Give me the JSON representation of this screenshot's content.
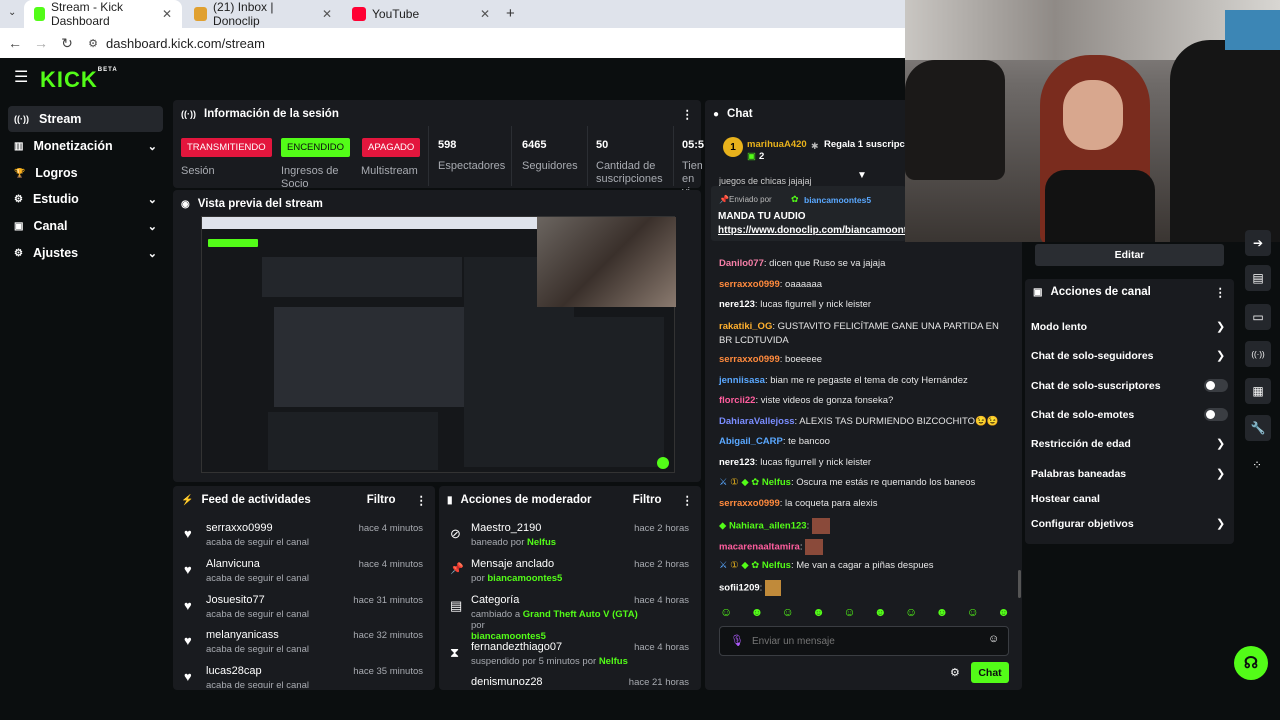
{
  "browser": {
    "tabs": [
      {
        "label": "Stream - Kick Dashboard",
        "active": true,
        "color": "#53fc18"
      },
      {
        "label": "(21) Inbox | Donoclip",
        "active": false,
        "color": "#e0a030"
      },
      {
        "label": "YouTube",
        "active": false,
        "color": "#ff0033"
      }
    ],
    "new_tab": "+",
    "url": "dashboard.kick.com/stream"
  },
  "brand": {
    "logo": "KICK",
    "beta": "BETA",
    "accent": "#53fc18"
  },
  "sidebar": {
    "items": [
      {
        "label": "Stream",
        "icon": "broadcast-icon",
        "glyph": "((·))"
      },
      {
        "label": "Monetización",
        "icon": "monetization-icon",
        "glyph": "▥"
      },
      {
        "label": "Logros",
        "icon": "trophy-icon",
        "glyph": "🏆"
      },
      {
        "label": "Estudio",
        "icon": "studio-icon",
        "glyph": "⚙"
      },
      {
        "label": "Canal",
        "icon": "channel-icon",
        "glyph": "▣"
      },
      {
        "label": "Ajustes",
        "icon": "gear-icon",
        "glyph": "⚙"
      }
    ]
  },
  "session": {
    "title": "Información de la sesión",
    "status": [
      {
        "badge": "TRANSMITIENDO",
        "label": "Sesión",
        "color": "#e3163d"
      },
      {
        "badge": "ENCENDIDO",
        "label": "Ingresos de Socio",
        "color": "#53fc18"
      },
      {
        "badge": "APAGADO",
        "label": "Multistream",
        "color": "#e3163d"
      }
    ],
    "stats": [
      {
        "value": "598",
        "label": "Espectadores"
      },
      {
        "value": "6465",
        "label": "Seguidores"
      },
      {
        "value": "50",
        "label": "Cantidad de suscripciones"
      },
      {
        "value": "05:5",
        "label": "Tiem en vi"
      }
    ]
  },
  "preview": {
    "title": "Vista previa del stream"
  },
  "feed": {
    "title": "Feed de actividades",
    "filter": "Filtro",
    "items": [
      {
        "name": "serraxxo0999",
        "sub": "acaba de seguir el canal",
        "time": "hace 4 minutos"
      },
      {
        "name": "Alanvicuna",
        "sub": "acaba de seguir el canal",
        "time": "hace 4 minutos"
      },
      {
        "name": "Josuesito77",
        "sub": "acaba de seguir el canal",
        "time": "hace 31 minutos"
      },
      {
        "name": "melanyanicass",
        "sub": "acaba de seguir el canal",
        "time": "hace 32 minutos"
      },
      {
        "name": "lucas28cap",
        "sub": "acaba de seguir el canal",
        "time": "hace 35 minutos"
      }
    ]
  },
  "mod": {
    "title": "Acciones de moderador",
    "filter": "Filtro",
    "items": [
      {
        "icon": "ban-icon",
        "glyph": "⊘",
        "name": "Maestro_2190",
        "pre": "baneado por ",
        "by": "Nelfus",
        "time": "hace 2 horas"
      },
      {
        "icon": "pin-icon",
        "glyph": "📌",
        "name": "Mensaje anclado",
        "pre": "por ",
        "by": "biancamoontes5",
        "time": "hace 2 horas"
      },
      {
        "icon": "category-icon",
        "glyph": "▤",
        "name": "Categoría",
        "pre": "cambiado a ",
        "by": "Grand Theft Auto V (GTA)",
        "post": " por",
        "by2": "biancamoontes5",
        "time": "hace 4 horas"
      },
      {
        "icon": "timeout-icon",
        "glyph": "⧗",
        "name": "fernandezthiago07",
        "pre": "suspendido por 5 minutos por ",
        "by": "Nelfus",
        "time": "hace 4 horas"
      },
      {
        "icon": "user-icon",
        "glyph": "",
        "name": "denismunoz28",
        "pre": "",
        "by": "",
        "time": "hace 21 horas"
      }
    ]
  },
  "chat": {
    "title": "Chat",
    "gift_user": "marihuaA420",
    "gift_count": "2",
    "gift_rank": "1",
    "gift_text": "Regala 1 suscripció",
    "pinned_label": "Enviado por",
    "pinned_user": "biancamoontes5",
    "pinned_text": "MANDA TU AUDIO",
    "pinned_link": "https://www.donoclip.com/biancamoonte",
    "partial_line": "juegos de chicas jajajaj",
    "messages": [
      {
        "user": "Danilo077",
        "color": "#f77fa8",
        "text": "dicen que Ruso se va jajaja"
      },
      {
        "user": "serraxxo0999",
        "color": "#ff8a3d",
        "text": "oaaaaaa"
      },
      {
        "user": "nere123",
        "color": "#ffffff",
        "text": "lucas figurrell y nick leister"
      },
      {
        "user": "rakatiki_OG",
        "color": "#ffb02e",
        "text": "GUSTAVITO FELICÍTAME GANE UNA PARTIDA EN BR LCDTUVIDA"
      },
      {
        "user": "serraxxo0999",
        "color": "#ff8a3d",
        "text": "boeeeee"
      },
      {
        "user": "jenniisasa",
        "color": "#5aa8ff",
        "text": "bian me re pegaste el tema de coty Hernández"
      },
      {
        "user": "florcii22",
        "color": "#ff5e9e",
        "text": "viste videos de gonza fonseka?"
      },
      {
        "user": "DahiaraVallejoss",
        "color": "#7a8dff",
        "text": "ALEXIS TAS DURMIENDO BIZCOCHITO😉😉"
      },
      {
        "user": "Abigail_CARP",
        "color": "#5aa8ff",
        "text": "te bancoo"
      },
      {
        "user": "nere123",
        "color": "#ffffff",
        "text": "lucas figurrell y nick leister"
      },
      {
        "user": "Nelfus",
        "color": "#53fc18",
        "text": "Oscura me estás re quemando los baneos"
      },
      {
        "user": "serraxxo0999",
        "color": "#ff8a3d",
        "text": "la coqueta para alexis"
      },
      {
        "user": "Nahiara_ailen123",
        "color": "#53fc18",
        "text": ""
      },
      {
        "user": "macarenaaltamira",
        "color": "#ff5e9e",
        "text": ""
      },
      {
        "user": "Nelfus",
        "color": "#53fc18",
        "text": "Me van a cagar a piñas despues"
      },
      {
        "user": "sofii1209",
        "color": "#ffffff",
        "text": ""
      }
    ],
    "input_placeholder": "Enviar un mensaje",
    "send_label": "Chat"
  },
  "channel": {
    "edit_label": "Editar",
    "title": "Acciones de canal",
    "items": [
      {
        "label": "Modo lento",
        "control": "chevron"
      },
      {
        "label": "Chat de solo-seguidores",
        "control": "chevron"
      },
      {
        "label": "Chat de solo-suscriptores",
        "control": "toggle"
      },
      {
        "label": "Chat de solo-emotes",
        "control": "toggle"
      },
      {
        "label": "Restricción de edad",
        "control": "chevron"
      },
      {
        "label": "Palabras baneadas",
        "control": "chevron"
      },
      {
        "label": "Hostear canal",
        "control": "none"
      },
      {
        "label": "Configurar objetivos",
        "control": "chevron"
      }
    ]
  }
}
